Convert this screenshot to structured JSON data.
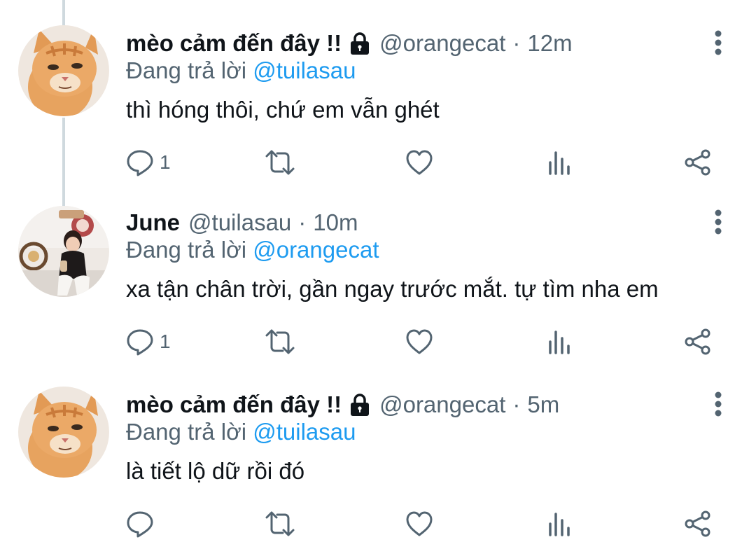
{
  "tweets": [
    {
      "display_name": "mèo cảm đến đây !!",
      "handle": "@orangecat",
      "separator": "·",
      "time": "12m",
      "replying_prefix": "Đang trả lời",
      "replying_to": "@tuilasau",
      "text": "thì hóng thôi, chứ em vẫn ghét",
      "reply_count": "1",
      "protected": true
    },
    {
      "display_name": "June",
      "handle": "@tuilasau",
      "separator": "·",
      "time": "10m",
      "replying_prefix": "Đang trả lời",
      "replying_to": "@orangecat",
      "text": "xa tận chân trời, gần ngay trước mắt. tự tìm nha em",
      "reply_count": "1",
      "protected": false
    },
    {
      "display_name": "mèo cảm đến đây !!",
      "handle": "@orangecat",
      "separator": "·",
      "time": "5m",
      "replying_prefix": "Đang trả lời",
      "replying_to": "@tuilasau",
      "text": "là tiết lộ dữ rồi đó",
      "reply_count": "",
      "protected": true
    }
  ],
  "colors": {
    "text": "#0f1419",
    "secondary": "#536471",
    "accent": "#1d9bf0",
    "thread_line": "#cfd9de"
  },
  "icons": [
    "lock-icon",
    "more-icon",
    "reply-icon",
    "retweet-icon",
    "like-icon",
    "views-icon",
    "share-icon"
  ]
}
